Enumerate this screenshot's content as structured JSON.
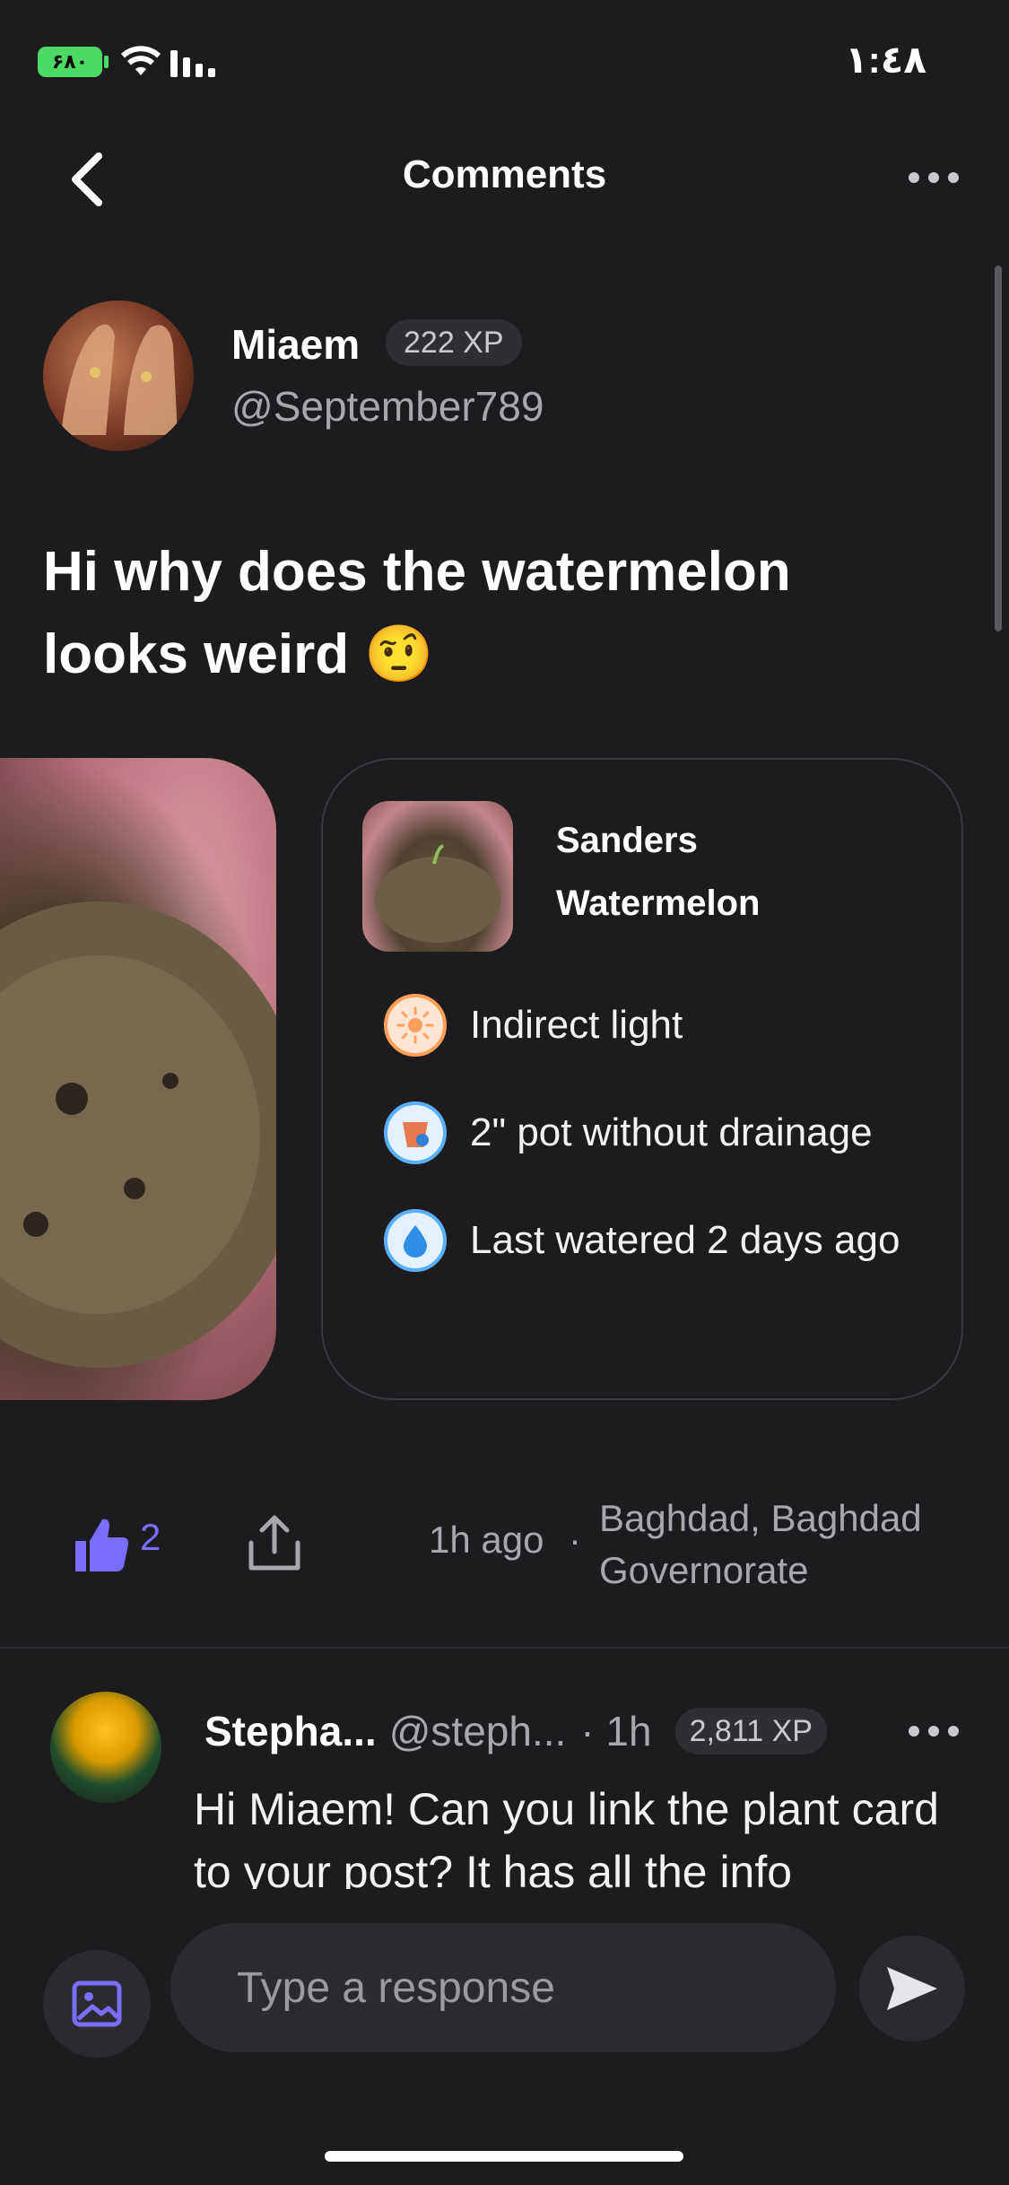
{
  "status_bar": {
    "battery_label": "۶۸٠",
    "time": "١:٤٨"
  },
  "nav": {
    "title": "Comments"
  },
  "post": {
    "author_name": "Miaem",
    "author_xp": "222 XP",
    "author_handle": "@September789",
    "text": "Hi why does the watermelon looks weird 🤨",
    "likes": "2",
    "time": "1h ago",
    "separator": "·",
    "location": "Baghdad, Baghdad Governorate"
  },
  "plant_card": {
    "owner": "Sanders",
    "plant": "Watermelon",
    "details": [
      {
        "icon": "sun-icon",
        "label": "Indirect light",
        "color": "#ff9f5a"
      },
      {
        "icon": "pot-icon",
        "label": "2\" pot without drainage",
        "color": "#5ab0ff"
      },
      {
        "icon": "water-drop-icon",
        "label": "Last watered 2 days ago",
        "color": "#5ab0ff"
      }
    ]
  },
  "comment": {
    "name": "Stepha...",
    "handle": "@steph...",
    "time": "· 1h",
    "xp": "2,811 XP",
    "text": "Hi Miaem! Can you link the plant card to your post? It has all the info"
  },
  "composer": {
    "placeholder": "Type a response"
  },
  "colors": {
    "accent": "#7b6dff",
    "background": "#1c1c1e",
    "battery": "#4cd964"
  }
}
